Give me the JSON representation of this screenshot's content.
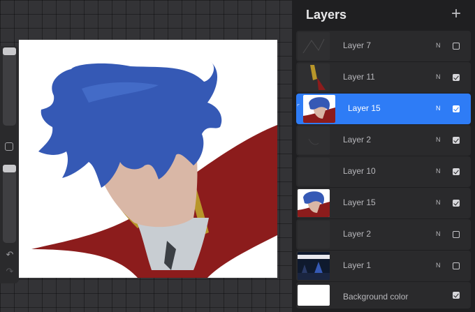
{
  "panel": {
    "title": "Layers",
    "add_icon": "plus-icon"
  },
  "layers": [
    {
      "name": "Layer 7",
      "blend": "N",
      "visible": false,
      "active": false,
      "thumbnail": "sketch-lines"
    },
    {
      "name": "Layer 11",
      "blend": "N",
      "visible": true,
      "active": false,
      "thumbnail": "gold-strap"
    },
    {
      "name": "Layer 15",
      "blend": "N",
      "visible": true,
      "active": true,
      "clipped": true,
      "thumbnail": "character"
    },
    {
      "name": "Layer 2",
      "blend": "N",
      "visible": true,
      "active": false,
      "thumbnail": "dark-sketch"
    },
    {
      "name": "Layer 10",
      "blend": "N",
      "visible": true,
      "active": false,
      "thumbnail": "empty"
    },
    {
      "name": "Layer 15",
      "blend": "N",
      "visible": true,
      "active": false,
      "thumbnail": "character"
    },
    {
      "name": "Layer 2",
      "blend": "N",
      "visible": false,
      "active": false,
      "thumbnail": "empty"
    },
    {
      "name": "Layer 1",
      "blend": "N",
      "visible": false,
      "active": false,
      "thumbnail": "night-scene"
    }
  ],
  "background_layer": {
    "name": "Background color",
    "visible": true,
    "color": "#ffffff"
  },
  "colors": {
    "accent": "#2e7cf6",
    "hair": "#3559b5",
    "cape": "#8c1c1c",
    "skin": "#d9b7a6",
    "gold": "#b8962a"
  },
  "sidebar": {
    "undo_icon": "undo-icon",
    "redo_icon": "redo-icon"
  }
}
